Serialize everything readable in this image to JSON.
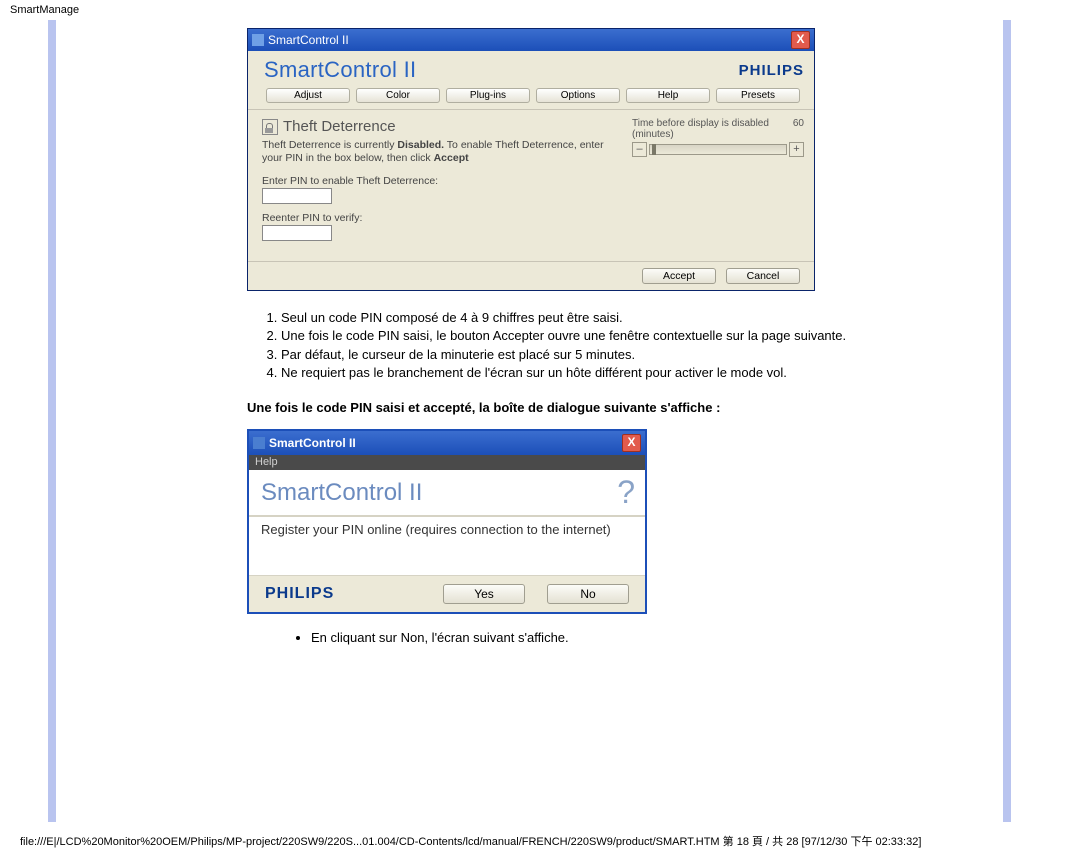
{
  "page_header": "SmartManage",
  "win1": {
    "title": "SmartControl II",
    "app_title": "SmartControl II",
    "brand": "PHILIPS",
    "tabs": [
      "Adjust",
      "Color",
      "Plug-ins",
      "Options",
      "Help",
      "Presets"
    ],
    "section_title": "Theft Deterrence",
    "disabled_text_1": "Theft Deterrence is currently ",
    "disabled_text_bold": "Disabled.",
    "disabled_text_2": " To enable Theft Deterrence, enter your PIN in the box below, then click ",
    "disabled_text_bold2": "Accept",
    "pin_label_1": "Enter PIN to enable Theft Deterrence:",
    "pin_label_2": "Reenter PIN to verify:",
    "time_label_1": "Time before display is disabled",
    "time_label_2": "(minutes)",
    "time_value": "60",
    "minus": "–",
    "plus": "+",
    "accept": "Accept",
    "cancel": "Cancel"
  },
  "ol": [
    "Seul un code PIN composé de 4 à 9 chiffres peut être saisi.",
    "Une fois le code PIN saisi, le bouton Accepter ouvre une fenêtre contextuelle sur la page suivante.",
    "Par défaut, le curseur de la minuterie est placé sur 5 minutes.",
    "Ne requiert pas le branchement de l'écran sur un hôte différent pour activer le mode vol."
  ],
  "bold_line": "Une fois le code PIN saisi et accepté, la boîte de dialogue suivante s'affiche :",
  "win2": {
    "title": "SmartControl II",
    "menu": "Help",
    "app_title": "SmartControl II",
    "qmark": "?",
    "message": "Register your PIN online (requires connection to the internet)",
    "brand": "PHILIPS",
    "yes": "Yes",
    "no": "No"
  },
  "bullet": "En cliquant sur Non, l'écran suivant s'affiche.",
  "footer": "file:///E|/LCD%20Monitor%20OEM/Philips/MP-project/220SW9/220S...01.004/CD-Contents/lcd/manual/FRENCH/220SW9/product/SMART.HTM 第 18 頁 / 共 28 [97/12/30 下午 02:33:32]"
}
